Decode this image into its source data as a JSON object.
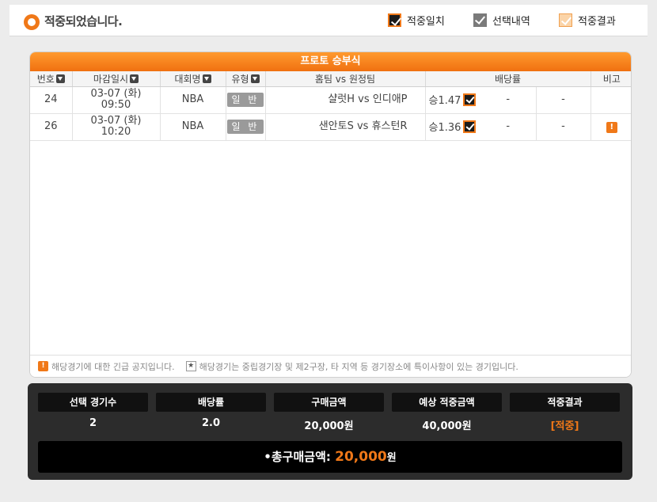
{
  "header": {
    "title": "적중되었습니다.",
    "legend": [
      "적중일치",
      "선택내역",
      "적중결과"
    ]
  },
  "panel": {
    "title": "프로토 승부식",
    "columns": [
      "번호",
      "마감일시",
      "대회명",
      "유형",
      "홈팀 vs 원정팀",
      "배당률",
      "비고"
    ],
    "rows": [
      {
        "no": "24",
        "date": "03-07 (화)",
        "time": "09:50",
        "league": "NBA",
        "type": "일 반",
        "match": "샬럿H vs 인디애P",
        "odds": "승1.47",
        "draw": "-",
        "away": "-",
        "remark": ""
      },
      {
        "no": "26",
        "date": "03-07 (화)",
        "time": "10:20",
        "league": "NBA",
        "type": "일 반",
        "match": "샌안토S vs 휴스턴R",
        "odds": "승1.36",
        "draw": "-",
        "away": "-",
        "remark": "!"
      }
    ],
    "note_warn": "해당경기에 대한 긴급 공지입니다.",
    "note_star": "해당경기는 중립경기장 및 제2구장, 타 지역 등 경기장소에 특이사항이 있는 경기입니다."
  },
  "summary": {
    "labels": [
      "선택 경기수",
      "배당률",
      "구매금액",
      "예상 적중금액",
      "적중결과"
    ],
    "values": [
      "2",
      "2.0",
      "20,000원",
      "40,000원",
      "[적중]"
    ],
    "total_label": "•총구매금액:",
    "total_amount": "20,000",
    "total_unit": "원"
  },
  "colors": {
    "accent": "#f07818",
    "dark": "#2c2c2c"
  }
}
